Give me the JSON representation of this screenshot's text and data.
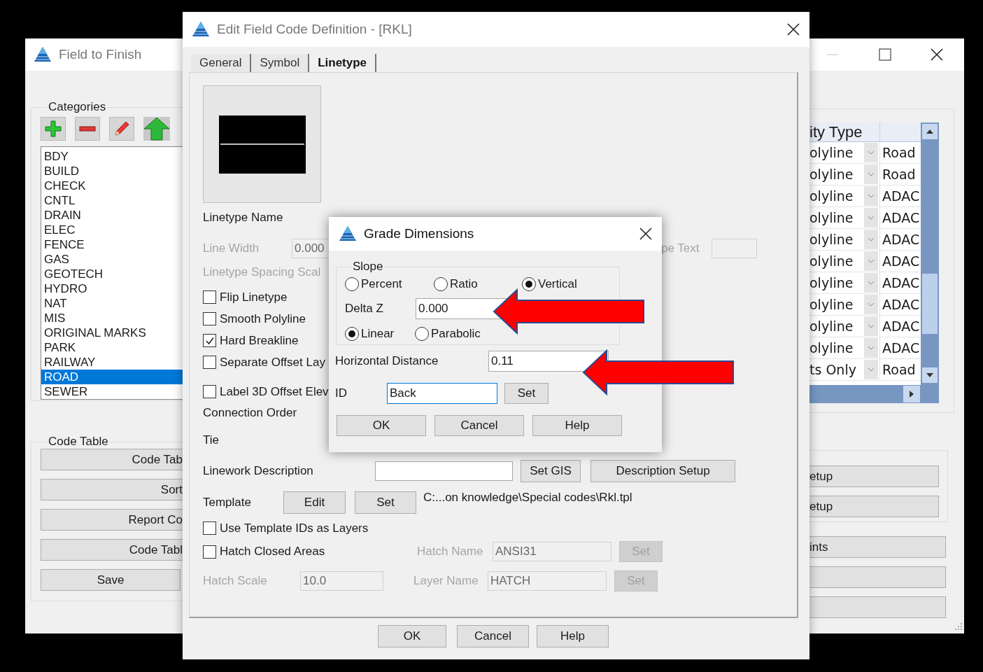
{
  "background_window": {
    "title": "Field to Finish",
    "categories": {
      "label": "Categories",
      "items": [
        {
          "label": "BDY",
          "selected": false
        },
        {
          "label": "BUILD",
          "selected": false
        },
        {
          "label": "CHECK",
          "selected": false
        },
        {
          "label": "CNTL",
          "selected": false
        },
        {
          "label": "DRAIN",
          "selected": false
        },
        {
          "label": "ELEC",
          "selected": false
        },
        {
          "label": "FENCE",
          "selected": false
        },
        {
          "label": "GAS",
          "selected": false
        },
        {
          "label": "GEOTECH",
          "selected": false
        },
        {
          "label": "HYDRO",
          "selected": false
        },
        {
          "label": "NAT",
          "selected": false
        },
        {
          "label": "MIS",
          "selected": false
        },
        {
          "label": "ORIGINAL MARKS",
          "selected": false
        },
        {
          "label": "PARK",
          "selected": false
        },
        {
          "label": "RAILWAY",
          "selected": false
        },
        {
          "label": "ROAD",
          "selected": true
        },
        {
          "label": "SEWER",
          "selected": false
        }
      ]
    },
    "code_table": {
      "label": "Code Table",
      "buttons": [
        "Code Tab",
        "Sort",
        "Report Co",
        "Code Tabl",
        "Save"
      ]
    },
    "table": {
      "header": "ity Type",
      "rows": [
        {
          "column_1": "olyline",
          "column_2": "Road"
        },
        {
          "column_1": "olyline",
          "column_2": "Road"
        },
        {
          "column_1": "olyline",
          "column_2": "ADAC"
        },
        {
          "column_1": "olyline",
          "column_2": "ADAC"
        },
        {
          "column_1": "olyline",
          "column_2": "ADAC"
        },
        {
          "column_1": "olyline",
          "column_2": "ADAC"
        },
        {
          "column_1": "olyline",
          "column_2": "ADAC"
        },
        {
          "column_1": "olyline",
          "column_2": "ADAC"
        },
        {
          "column_1": "olyline",
          "column_2": "ADAC"
        },
        {
          "column_1": "olyline",
          "column_2": "ADAC"
        },
        {
          "column_1": "ts Only",
          "column_2": "Road"
        }
      ]
    },
    "setup_buttons": [
      "etup",
      "etup"
    ],
    "buttons": [
      "ints"
    ]
  },
  "edit_dialog": {
    "title": "Edit Field Code Definition - [RKL]",
    "tabs": [
      {
        "label": "General",
        "selected": false
      },
      {
        "label": "Symbol",
        "selected": false
      },
      {
        "label": "Linetype",
        "selected": true
      }
    ],
    "linetype_name_label": "Linetype Name",
    "line_width": {
      "label": "Line Width",
      "value": "0.000",
      "disabled": true
    },
    "text_setting": {
      "label": "pe Text",
      "disabled": true
    },
    "spacing_scale": {
      "label": "Linetype Spacing Scal",
      "disabled": true
    },
    "checkboxes": [
      {
        "label": "Flip Linetype",
        "checked": false
      },
      {
        "label": "Smooth Polyline",
        "checked": false
      },
      {
        "label": "Hard Breakline",
        "checked": true
      },
      {
        "label": "Separate Offset Lay",
        "checked": false
      }
    ],
    "label_3d": {
      "label": "Label 3D Offset Elev",
      "checked": false
    },
    "connection_order_label": "Connection Order",
    "tie_label": "Tie",
    "linework": {
      "label": "Linework Description",
      "buttons": [
        "Set GIS",
        "Description Setup"
      ]
    },
    "template": {
      "label": "Template",
      "buttons": [
        "Edit",
        "Set"
      ],
      "path": "C:...on knowledge\\Special codes\\Rkl.tpl"
    },
    "use_template_ids": {
      "label": "Use Template IDs as Layers",
      "checked": false
    },
    "hatch_closed": {
      "label": "Hatch Closed Areas",
      "checked": false
    },
    "hatch_name": {
      "label": "Hatch Name",
      "value": "ANSI31",
      "button": "Set",
      "disabled": true
    },
    "hatch_scale": {
      "label": "Hatch Scale",
      "value": "10.0",
      "disabled": true
    },
    "layer_name": {
      "label": "Layer Name",
      "value": "HATCH",
      "button": "Set",
      "disabled": true
    },
    "buttons": [
      "OK",
      "Cancel",
      "Help"
    ]
  },
  "grade_dialog": {
    "title": "Grade Dimensions",
    "slope": {
      "label": "Slope",
      "modes": [
        {
          "label": "Percent",
          "selected": false
        },
        {
          "label": "Ratio",
          "selected": false
        },
        {
          "label": "Vertical",
          "selected": true
        }
      ],
      "delta_z": {
        "label": "Delta Z",
        "value": "0.000"
      },
      "curves": [
        {
          "label": "Linear",
          "selected": true
        },
        {
          "label": "Parabolic",
          "selected": false
        }
      ]
    },
    "horizontal_distance": {
      "label": "Horizontal Distance",
      "value": "0.11"
    },
    "id": {
      "label": "ID",
      "value": "Back",
      "button": "Set",
      "focused": true
    },
    "buttons": [
      "OK",
      "Cancel",
      "Help"
    ]
  }
}
